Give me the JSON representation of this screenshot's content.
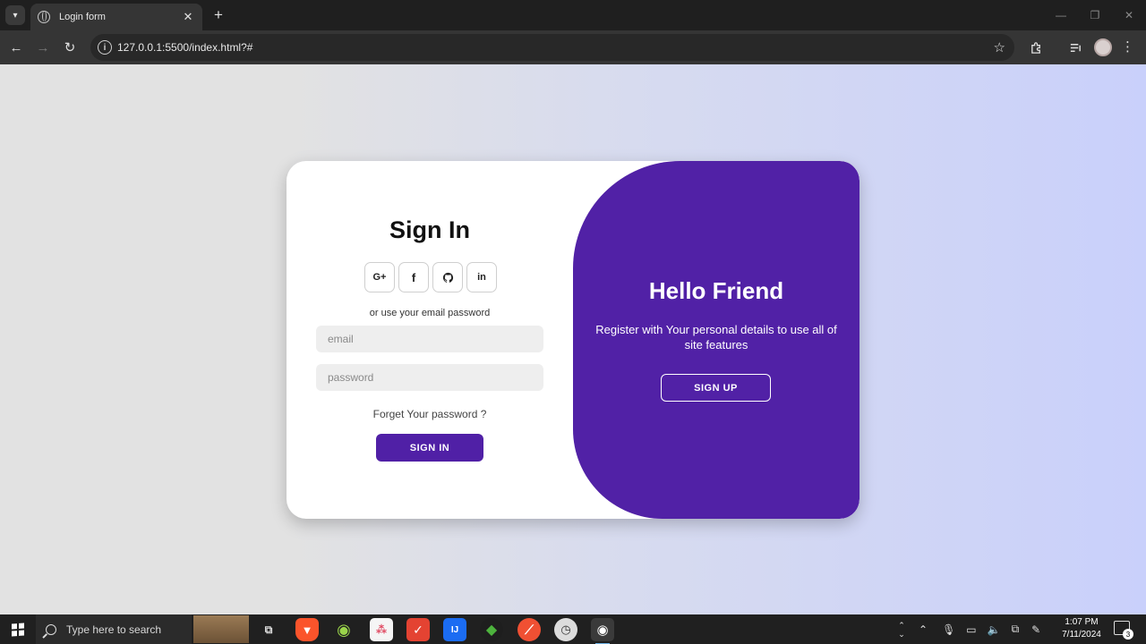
{
  "browser": {
    "tab_title": "Login form",
    "tab_close": "✕",
    "new_tab": "+",
    "url": "127.0.0.1:5500/index.html?#",
    "window_controls": {
      "minimize": "—",
      "restore": "❐",
      "close": "✕"
    }
  },
  "signin": {
    "title": "Sign In",
    "socials": [
      {
        "label": "G+",
        "icon": "google-icon"
      },
      {
        "label": "f",
        "icon": "facebook-icon"
      },
      {
        "label": "",
        "icon": "github-icon"
      },
      {
        "label": "in",
        "icon": "linkedin-icon"
      }
    ],
    "alt_text": "or use your email password",
    "email_placeholder": "email",
    "password_placeholder": "password",
    "forgot_text": "Forget Your password ?",
    "button_label": "SIGN IN"
  },
  "hello": {
    "title": "Hello Friend",
    "text": "Register with Your personal details to use all of site features",
    "button_label": "SIGN UP"
  },
  "taskbar": {
    "search_placeholder": "Type here to search",
    "time": "1:07 PM",
    "date": "7/11/2024",
    "notification_count": "3"
  },
  "colors": {
    "accent": "#5121a6",
    "button": "#5020a6",
    "page_left": "#e2e2e2",
    "page_right": "#c9d0fb"
  }
}
